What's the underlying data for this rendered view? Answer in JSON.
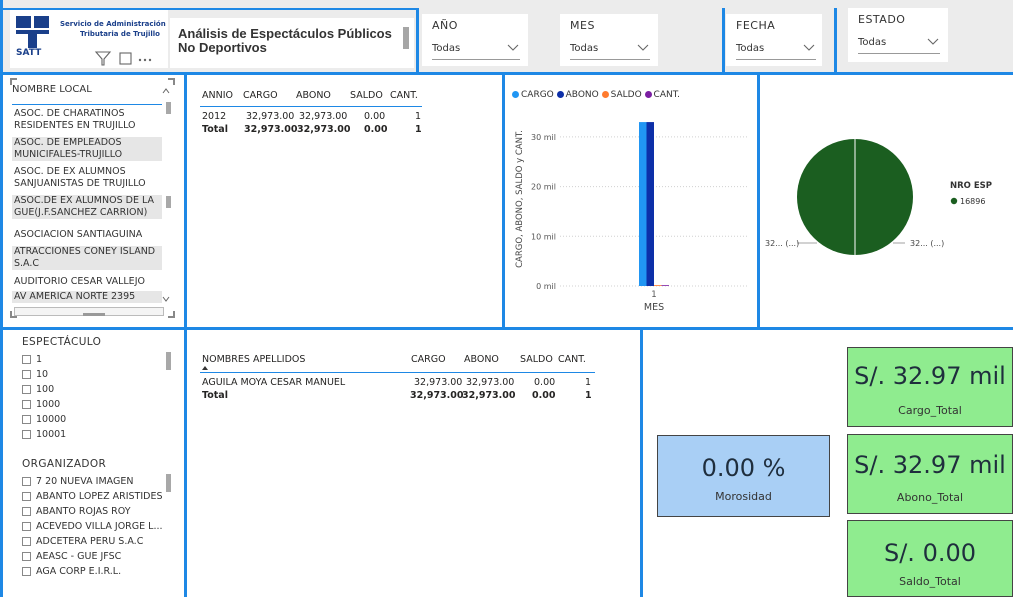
{
  "header": {
    "logo": {
      "org_line1": "Servicio de Administración",
      "org_line2": "Tributaria de Trujillo",
      "acronym": "SATT"
    },
    "title_line1": "Análisis de Espectáculos Públicos",
    "title_line2": "No Deportivos"
  },
  "filters": [
    {
      "label": "AÑO",
      "value": "Todas"
    },
    {
      "label": "MES",
      "value": "Todas"
    },
    {
      "label": "FECHA",
      "value": "Todas"
    },
    {
      "label": "ESTADO",
      "value": "Todas"
    }
  ],
  "local_list": {
    "header": "NOMBRE LOCAL",
    "items": [
      "ASOC. DE CHARATINOS RESIDENTES EN TRUJILLO",
      "ASOC. DE EMPLEADOS MUNICIFALES-TRUJILLO",
      "ASOC. DE EX ALUMNOS SANJUANISTAS DE TRUJILLO",
      "ASOC.DE EX ALUMNOS DE LA GUE(J.F.SANCHEZ CARRION)",
      "ASOCIACION SANTIAGUINA",
      "ATRACCIONES CONEY ISLAND S.A.C",
      "AUDITORIO CESAR VALLEJO",
      "AV AMERICA NORTE 2395"
    ]
  },
  "year_table": {
    "columns": [
      "ANNIO",
      "CARGO",
      "ABONO",
      "SALDO",
      "CANT."
    ],
    "rows": [
      [
        "2012",
        "32,973.00",
        "32,973.00",
        "0.00",
        "1"
      ]
    ],
    "total": [
      "Total",
      "32,973.00",
      "32,973.00",
      "0.00",
      "1"
    ]
  },
  "chart_data": {
    "type": "bar",
    "legend": [
      "CARGO",
      "ABONO",
      "SALDO",
      "CANT."
    ],
    "colors": [
      "#2196f3",
      "#0d2fa8",
      "#ff7b2e",
      "#7b1fa2"
    ],
    "categories": [
      "1"
    ],
    "series": [
      {
        "name": "CARGO",
        "values": [
          32973
        ]
      },
      {
        "name": "ABONO",
        "values": [
          32973
        ]
      },
      {
        "name": "SALDO",
        "values": [
          0
        ]
      },
      {
        "name": "CANT.",
        "values": [
          1
        ]
      }
    ],
    "xlabel": "MES",
    "ylabel": "CARGO, ABONO, SALDO y CANT.",
    "ylim": [
      0,
      35000
    ],
    "ticks": [
      {
        "v": 0,
        "label": "0 mil"
      },
      {
        "v": 10000,
        "label": "10 mil"
      },
      {
        "v": 20000,
        "label": "20 mil"
      },
      {
        "v": 30000,
        "label": "30 mil"
      }
    ]
  },
  "pie": {
    "legend_title": "NRO ESP",
    "legend_item": "16896",
    "color": "#1b5e20",
    "left_label": "32... (...)",
    "right_label": "32... (...)"
  },
  "espectaculo": {
    "header": "ESPECTÁCULO",
    "items": [
      "1",
      "10",
      "100",
      "1000",
      "10000",
      "10001"
    ]
  },
  "organizador": {
    "header": "ORGANIZADOR",
    "items": [
      "7 20 NUEVA IMAGEN",
      "ABANTO LOPEZ ARISTIDES",
      "ABANTO ROJAS ROY",
      "ACEVEDO VILLA JORGE L...",
      "ADCETERA PERU S.A.C",
      "AEASC - GUE JFSC",
      "AGA CORP E.I.R.L."
    ]
  },
  "person_table": {
    "columns": [
      "NOMBRES APELLIDOS",
      "CARGO",
      "ABONO",
      "SALDO",
      "CANT."
    ],
    "rows": [
      [
        "AGUILA MOYA CESAR MANUEL",
        "32,973.00",
        "32,973.00",
        "0.00",
        "1"
      ]
    ],
    "total": [
      "Total",
      "32,973.00",
      "32,973.00",
      "0.00",
      "1"
    ]
  },
  "kpis": {
    "morosidad": {
      "value": "0.00 %",
      "label": "Morosidad",
      "color": "#a9cff5"
    },
    "cargo": {
      "value": "S/. 32.97 mil",
      "label": "Cargo_Total",
      "color": "#8fec8f"
    },
    "abono": {
      "value": "S/. 32.97 mil",
      "label": "Abono_Total",
      "color": "#8fec8f"
    },
    "saldo": {
      "value": "S/. 0.00",
      "label": "Saldo_Total",
      "color": "#8fec8f"
    }
  }
}
